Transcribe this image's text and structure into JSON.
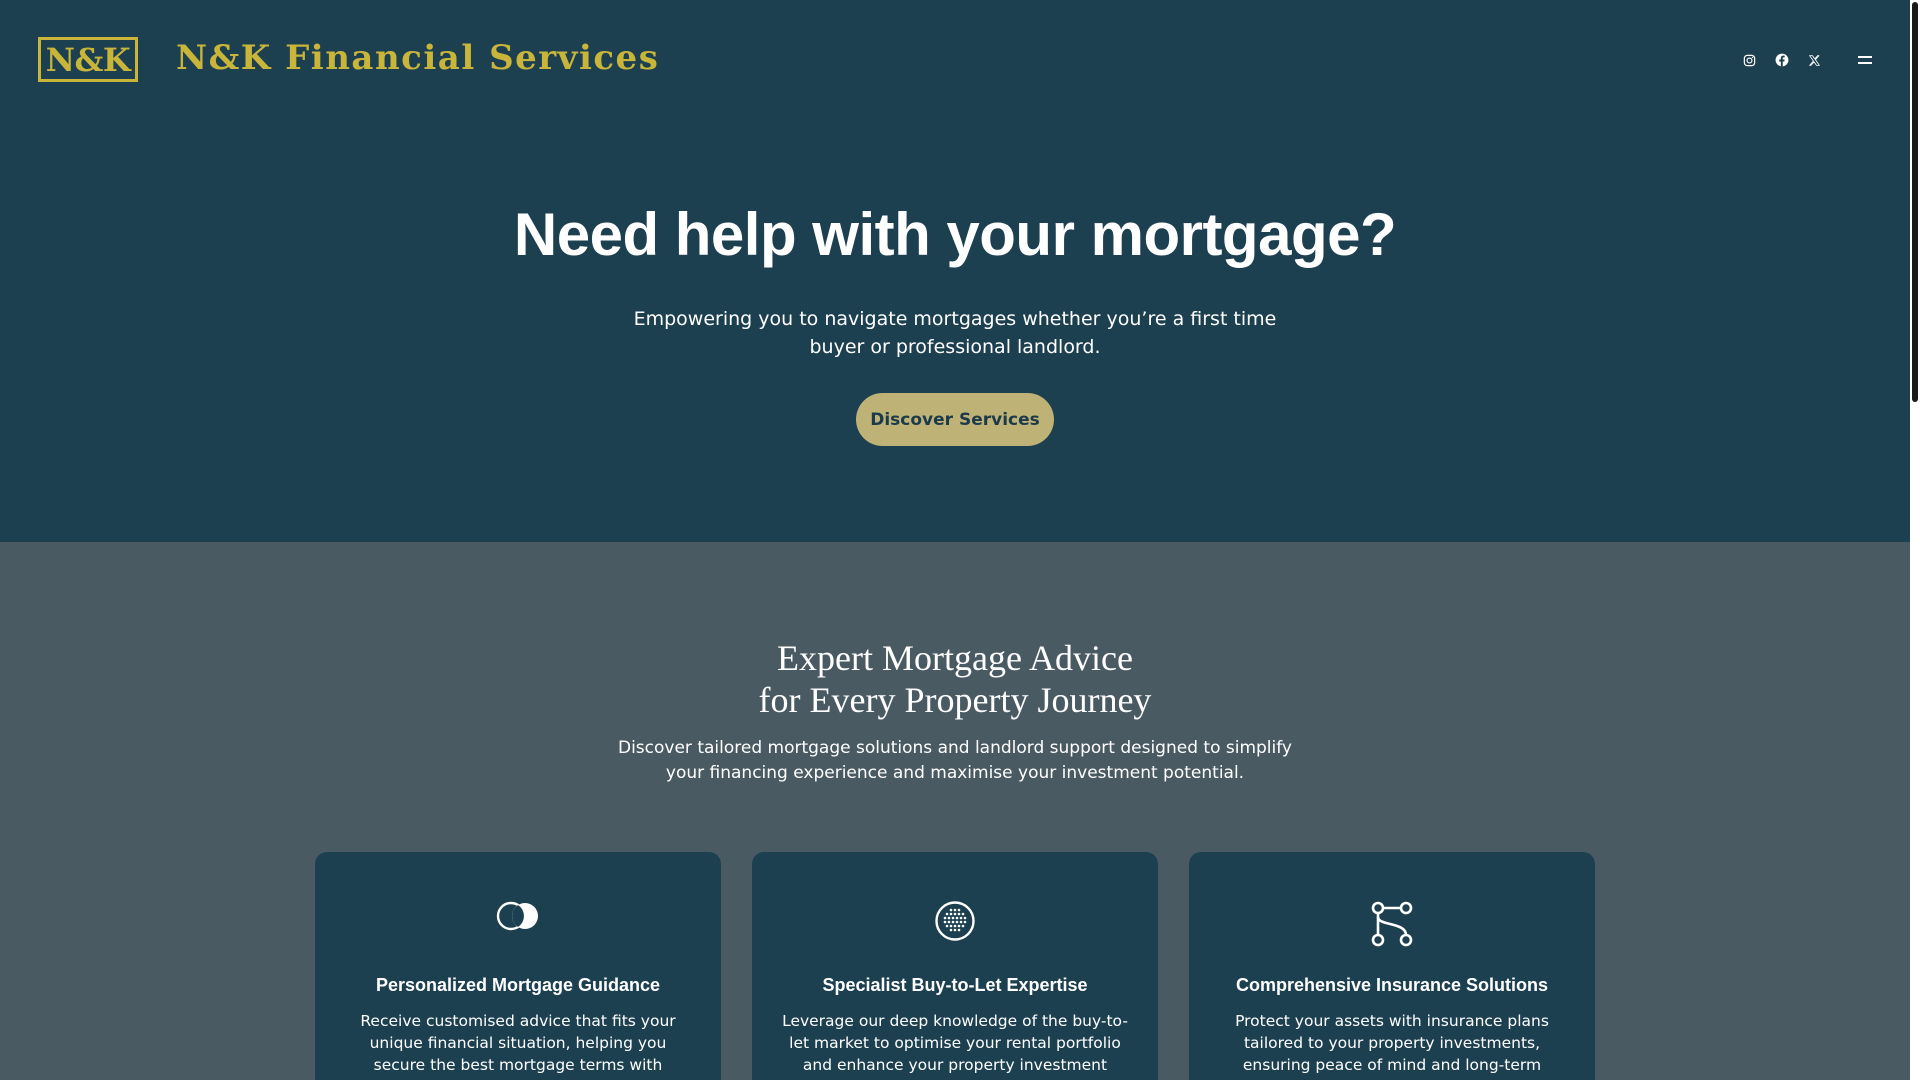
{
  "header": {
    "logo_text": "N&K",
    "brand_name": "N&K Financial Services",
    "social": [
      {
        "icon": "instagram-icon"
      },
      {
        "icon": "facebook-icon"
      },
      {
        "icon": "x-twitter-icon"
      }
    ],
    "menu_icon": "hamburger-menu-icon"
  },
  "hero": {
    "title": "Need help with your mortgage?",
    "subtitle": "Empowering you to navigate mortgages whether you’re a first time buyer or professional landlord.",
    "cta_label": "Discover Services"
  },
  "services": {
    "title_line1": "Expert Mortgage Advice",
    "title_line2": "for Every Property Journey",
    "subtitle": "Discover tailored mortgage solutions and landlord support designed to simplify your financing experience and maximise your investment potential.",
    "cards": [
      {
        "icon": "overlapping-circles-icon",
        "title": "Personalized Mortgage Guidance",
        "text": "Receive customised advice that fits your unique financial situation, helping you secure the best mortgage terms with confidence and"
      },
      {
        "icon": "dotted-globe-icon",
        "title": "Specialist Buy-to-Let Expertise",
        "text": "Leverage our deep knowledge of the buy-to-let market to optimise your rental portfolio and enhance your property investment"
      },
      {
        "icon": "workflow-nodes-icon",
        "title": "Comprehensive Insurance Solutions",
        "text": "Protect your assets with insurance plans tailored to your property investments, ensuring peace of mind and long-term"
      }
    ]
  },
  "colors": {
    "hero_bg": "#1d4050",
    "section_bg": "#4a5a62",
    "brand_gold": "#c9b53a",
    "cta_bg": "#bfb276",
    "cta_text": "#1d3a4a"
  }
}
